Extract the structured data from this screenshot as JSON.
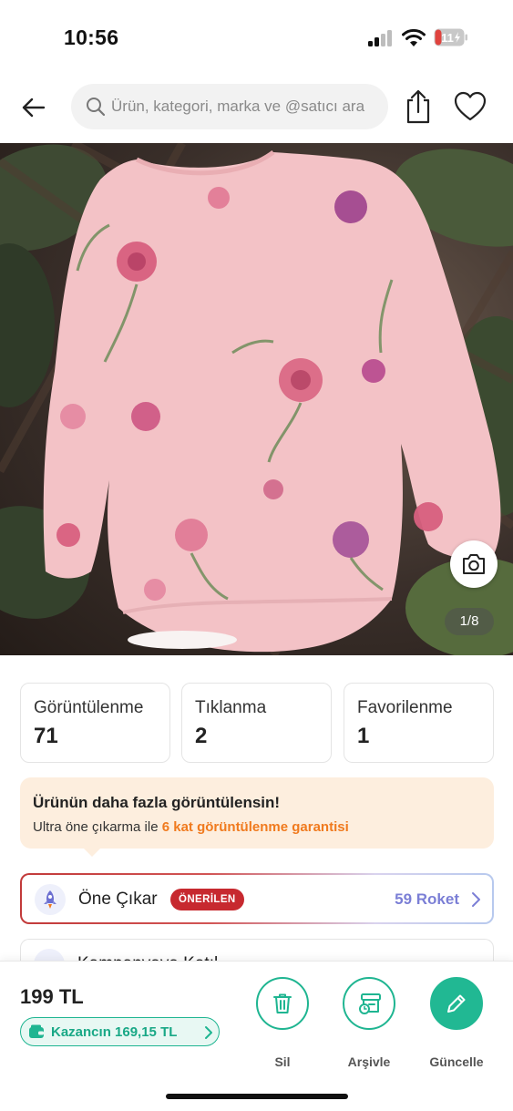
{
  "status_bar": {
    "time": "10:56",
    "battery": "11"
  },
  "header": {
    "search_placeholder": "Ürün, kategori, marka ve @satıcı ara"
  },
  "product": {
    "image_alt": "Pink floral long-sleeve baby bodysuit",
    "page_indicator": "1/8"
  },
  "stats": [
    {
      "label": "Görüntülenme",
      "value": "71"
    },
    {
      "label": "Tıklanma",
      "value": "2"
    },
    {
      "label": "Favorilenme",
      "value": "1"
    }
  ],
  "promo": {
    "title": "Ürünün daha fazla görüntülensin!",
    "subtitle_prefix": "Ultra öne çıkarma ile ",
    "subtitle_highlight": "6 kat görüntülenme garantisi"
  },
  "featured_option": {
    "label": "Öne Çıkar",
    "badge": "ÖNERİLEN",
    "price": "59 Roket"
  },
  "second_option": {
    "label": "Kampanyaya Katıl"
  },
  "bottom_bar": {
    "price": "199 TL",
    "earnings": "Kazancın 169,15 TL",
    "actions": [
      {
        "label": "Sil"
      },
      {
        "label": "Arşivle"
      },
      {
        "label": "Güncelle"
      }
    ]
  },
  "colors": {
    "accent_green": "#1fb591",
    "promo_orange": "#f07a1e",
    "badge_red": "#c7292f",
    "rocket_purple": "#7b7fd6"
  },
  "icons": [
    "back-arrow-icon",
    "search-icon",
    "share-icon",
    "heart-icon",
    "camera-icon",
    "rocket-icon",
    "chevron-right-icon",
    "wallet-icon",
    "trash-icon",
    "archive-icon",
    "pencil-icon"
  ]
}
